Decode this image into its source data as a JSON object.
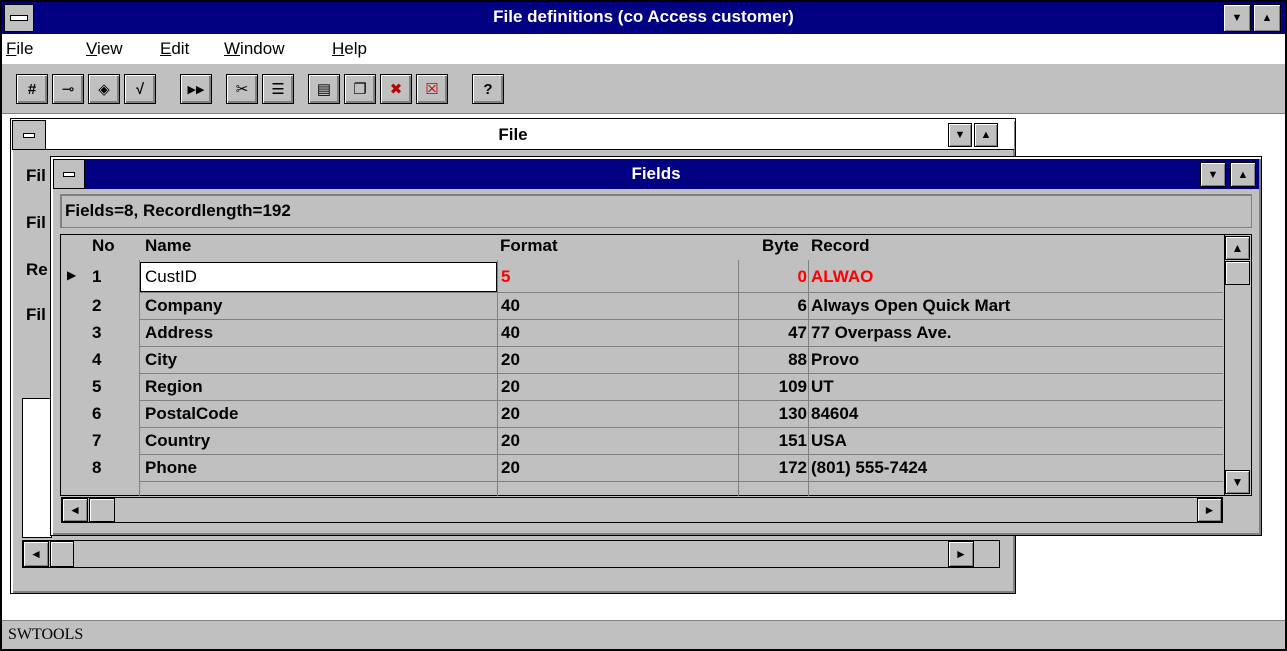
{
  "app": {
    "title": "File definitions (co Access customer)"
  },
  "menu": [
    {
      "label": "File",
      "underline": "F",
      "rest": "ile"
    },
    {
      "label": "View",
      "underline": "V",
      "rest": "iew"
    },
    {
      "label": "Edit",
      "underline": "E",
      "rest": "dit"
    },
    {
      "label": "Window",
      "underline": "W",
      "rest": "indow"
    },
    {
      "label": "Help",
      "underline": "H",
      "rest": "elp"
    }
  ],
  "toolbar": {
    "buttons": [
      {
        "name": "number-icon",
        "glyph": "#"
      },
      {
        "name": "key-icon",
        "glyph": "⊸"
      },
      {
        "name": "diamond-icon",
        "glyph": "◈"
      },
      {
        "name": "check-icon",
        "glyph": "√"
      },
      {
        "name": "fast-forward-icon",
        "glyph": "▶▶"
      },
      {
        "name": "cut-icon",
        "glyph": "✂"
      },
      {
        "name": "list-icon",
        "glyph": "☰"
      },
      {
        "name": "tile-icon",
        "glyph": "▤"
      },
      {
        "name": "cascade-icon",
        "glyph": "❐"
      },
      {
        "name": "close-windows-icon",
        "glyph": "✖"
      },
      {
        "name": "delete-icon",
        "glyph": "☒"
      },
      {
        "name": "help-icon",
        "glyph": "?"
      }
    ]
  },
  "file_window": {
    "title": "File",
    "labels": [
      "Fil",
      "Fil",
      "Re",
      "Fil"
    ]
  },
  "fields_window": {
    "title": "Fields",
    "summary": "Fields=8, Recordlength=192",
    "columns": {
      "no": "No",
      "name": "Name",
      "format": "Format",
      "byte": "Byte",
      "record": "Record"
    },
    "rows": [
      {
        "no": "1",
        "name": "CustID",
        "format": "5",
        "byte": "0",
        "record": "ALWAO",
        "selected": true
      },
      {
        "no": "2",
        "name": "Company",
        "format": "40",
        "byte": "6",
        "record": "Always Open Quick Mart"
      },
      {
        "no": "3",
        "name": "Address",
        "format": "40",
        "byte": "47",
        "record": "77 Overpass Ave."
      },
      {
        "no": "4",
        "name": "City",
        "format": "20",
        "byte": "88",
        "record": "Provo"
      },
      {
        "no": "5",
        "name": "Region",
        "format": "20",
        "byte": "109",
        "record": "UT"
      },
      {
        "no": "6",
        "name": "PostalCode",
        "format": "20",
        "byte": "130",
        "record": "84604"
      },
      {
        "no": "7",
        "name": "Country",
        "format": "20",
        "byte": "151",
        "record": "USA"
      },
      {
        "no": "8",
        "name": "Phone",
        "format": "20",
        "byte": "172",
        "record": "(801) 555-7424"
      }
    ]
  },
  "status": {
    "text": "SWTOOLS"
  },
  "colors": {
    "titlebar": "#000080",
    "highlight": "#ff0000",
    "face": "#c0c0c0"
  }
}
